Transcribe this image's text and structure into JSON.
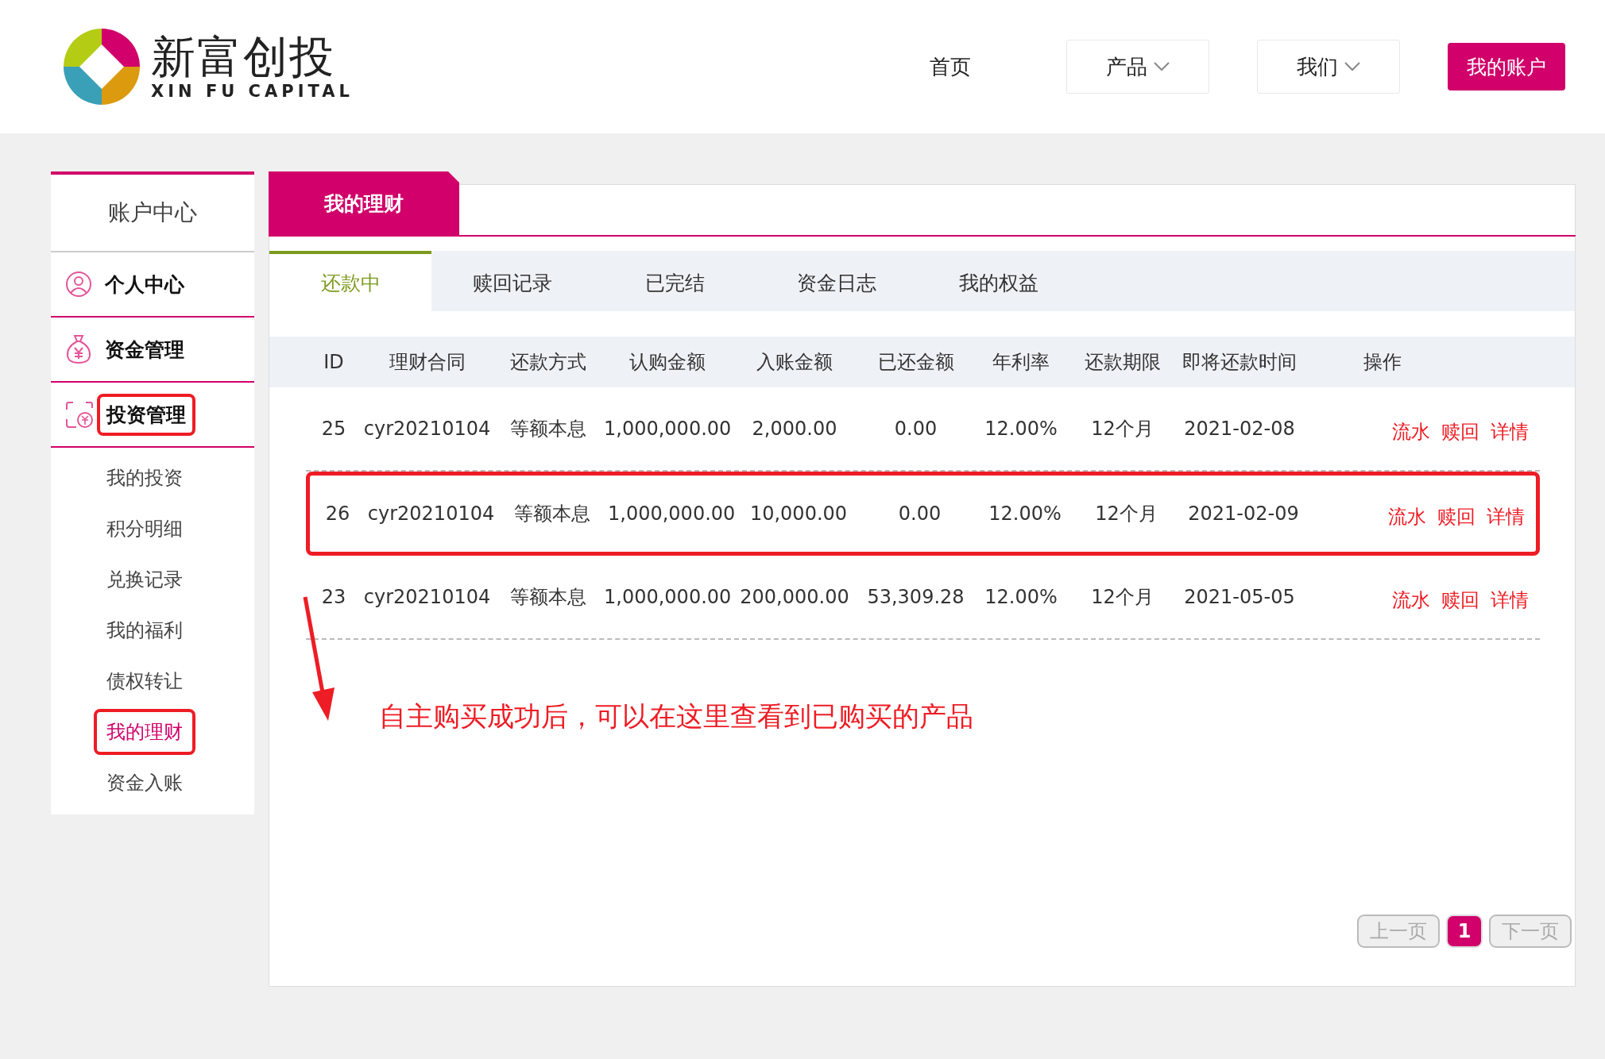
{
  "header": {
    "logo_text": "新富创投",
    "logo_subtext": "XIN FU CAPITAL",
    "nav": [
      {
        "label": "首页",
        "kind": "link"
      },
      {
        "label": "产品",
        "kind": "dropdown"
      },
      {
        "label": "我们",
        "kind": "dropdown"
      },
      {
        "label": "我的账户",
        "kind": "primary"
      }
    ]
  },
  "sidebar": {
    "title": "账户中心",
    "items": [
      {
        "label": "个人中心",
        "marked": false
      },
      {
        "label": "资金管理",
        "marked": false
      },
      {
        "label": "投资管理",
        "marked": true
      }
    ],
    "sub_items": [
      {
        "label": "我的投资",
        "selected": false,
        "marked": false
      },
      {
        "label": "积分明细",
        "selected": false,
        "marked": false
      },
      {
        "label": "兑换记录",
        "selected": false,
        "marked": false
      },
      {
        "label": "我的福利",
        "selected": false,
        "marked": false
      },
      {
        "label": "债权转让",
        "selected": false,
        "marked": false
      },
      {
        "label": "我的理财",
        "selected": true,
        "marked": true
      },
      {
        "label": "资金入账",
        "selected": false,
        "marked": false
      }
    ]
  },
  "panel": {
    "title": "我的理财",
    "tabs": [
      {
        "label": "还款中",
        "selected": true
      },
      {
        "label": "赎回记录",
        "selected": false
      },
      {
        "label": "已完结",
        "selected": false
      },
      {
        "label": "资金日志",
        "selected": false
      },
      {
        "label": "我的权益",
        "selected": false
      }
    ],
    "table": {
      "columns": [
        "ID",
        "理财合同",
        "还款方式",
        "认购金额",
        "入账金额",
        "已还金额",
        "年利率",
        "还款期限",
        "即将还款时间",
        "操作"
      ],
      "rows": [
        {
          "cells": [
            "25",
            "cyr20210104",
            "等额本息",
            "1,000,000.00",
            "2,000.00",
            "0.00",
            "12.00%",
            "12个月",
            "2021-02-08"
          ],
          "actions": [
            "流水",
            "赎回",
            "详情"
          ],
          "marked": false
        },
        {
          "cells": [
            "26",
            "cyr20210104",
            "等额本息",
            "1,000,000.00",
            "10,000.00",
            "0.00",
            "12.00%",
            "12个月",
            "2021-02-09"
          ],
          "actions": [
            "流水",
            "赎回",
            "详情"
          ],
          "marked": true
        },
        {
          "cells": [
            "23",
            "cyr20210104",
            "等额本息",
            "1,000,000.00",
            "200,000.00",
            "53,309.28",
            "12.00%",
            "12个月",
            "2021-05-05"
          ],
          "actions": [
            "流水",
            "赎回",
            "详情"
          ],
          "marked": false
        }
      ]
    },
    "annotation": "自主购买成功后，可以在这里查看到已购买的产品",
    "pagination": [
      {
        "label": "上一页",
        "kind": "prev",
        "disabled": true,
        "selected": false
      },
      {
        "label": "1",
        "kind": "page",
        "disabled": false,
        "selected": true
      },
      {
        "label": "下一页",
        "kind": "next",
        "disabled": true,
        "selected": false
      }
    ]
  }
}
